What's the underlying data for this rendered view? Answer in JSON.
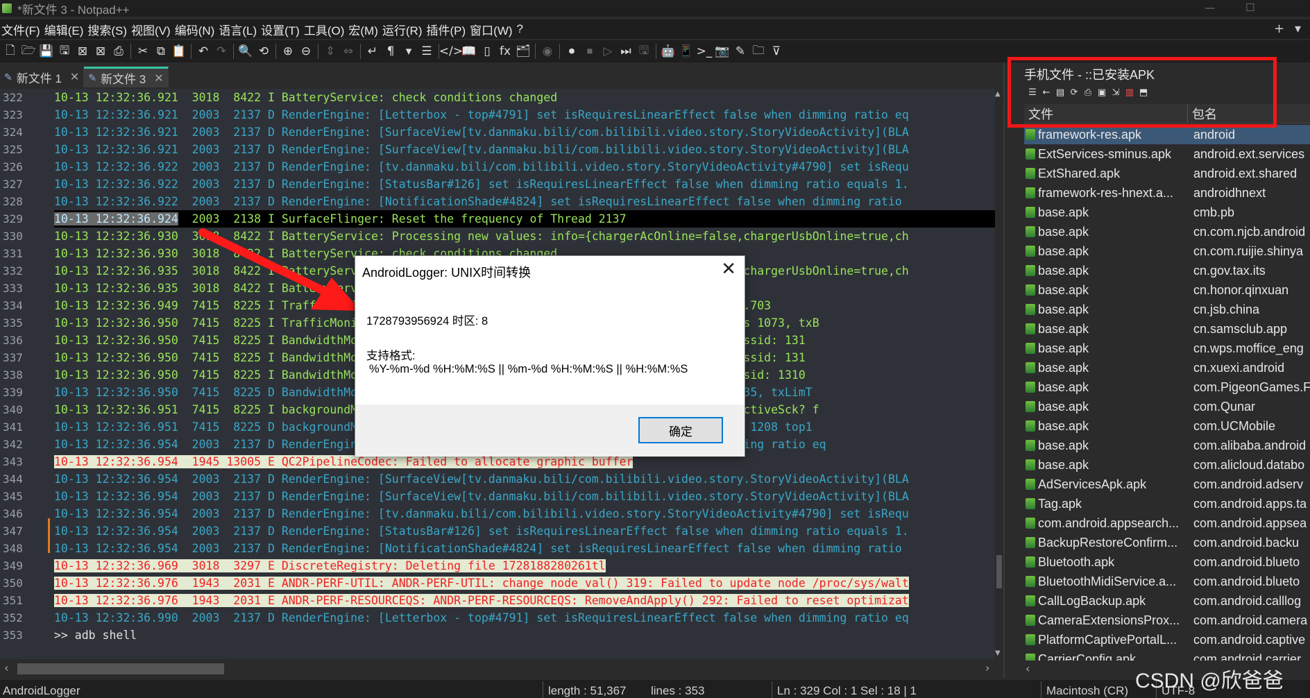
{
  "window": {
    "title": "*新文件 3 - Notpad++",
    "min": "—",
    "max": "☐"
  },
  "menu": [
    {
      "label": "文件(F)"
    },
    {
      "label": "编辑(E)"
    },
    {
      "label": "搜索(S)"
    },
    {
      "label": "视图(V)"
    },
    {
      "label": "编码(N)"
    },
    {
      "label": "语言(L)"
    },
    {
      "label": "设置(T)"
    },
    {
      "label": "工具(O)"
    },
    {
      "label": "宏(M)"
    },
    {
      "label": "运行(R)"
    },
    {
      "label": "插件(P)"
    },
    {
      "label": "窗口(W)"
    },
    {
      "label": "?"
    }
  ],
  "menu_right": {
    "plus": "+",
    "down": "▾"
  },
  "toolbar": [
    {
      "icon": "new-file-icon",
      "glyph": "🗋"
    },
    {
      "icon": "open-folder-icon",
      "glyph": "🗁"
    },
    {
      "icon": "save-icon",
      "glyph": "💾"
    },
    {
      "icon": "save-all-icon",
      "glyph": "🖫"
    },
    {
      "icon": "close-icon",
      "glyph": "⊠"
    },
    {
      "icon": "close-all-icon",
      "glyph": "⊠"
    },
    {
      "icon": "print-icon",
      "glyph": "⎙"
    },
    {
      "sep": true
    },
    {
      "icon": "cut-icon",
      "glyph": "✂"
    },
    {
      "icon": "copy-icon",
      "glyph": "⧉"
    },
    {
      "icon": "paste-icon",
      "glyph": "📋",
      "dis": true
    },
    {
      "sep": true
    },
    {
      "icon": "undo-icon",
      "glyph": "↶"
    },
    {
      "icon": "redo-icon",
      "glyph": "↷",
      "dis": true
    },
    {
      "sep": true
    },
    {
      "icon": "find-icon",
      "glyph": "🔍"
    },
    {
      "icon": "replace-icon",
      "glyph": "⟲"
    },
    {
      "sep": true
    },
    {
      "icon": "zoom-in-icon",
      "glyph": "⊕"
    },
    {
      "icon": "zoom-out-icon",
      "glyph": "⊖"
    },
    {
      "sep": true
    },
    {
      "icon": "sync-vertical-icon",
      "glyph": "⇕",
      "dis": true
    },
    {
      "icon": "sync-horizontal-icon",
      "glyph": "⇔",
      "dis": true
    },
    {
      "sep": true
    },
    {
      "icon": "word-wrap-icon",
      "glyph": "↵"
    },
    {
      "icon": "show-all-chars-icon",
      "glyph": "¶"
    },
    {
      "icon": "dropdown-icon",
      "glyph": "▾"
    },
    {
      "icon": "indent-guide-icon",
      "glyph": "☰"
    },
    {
      "sep": true
    },
    {
      "icon": "xml-tag-icon",
      "glyph": "</>"
    },
    {
      "icon": "book-icon",
      "glyph": "📖"
    },
    {
      "icon": "doc-map-icon",
      "glyph": "▯"
    },
    {
      "icon": "function-list-icon",
      "glyph": "fx"
    },
    {
      "icon": "folder-workspace-icon",
      "glyph": "🗂"
    },
    {
      "sep": true
    },
    {
      "icon": "monitor-icon",
      "glyph": "◉",
      "dis": true
    },
    {
      "sep": true
    },
    {
      "icon": "record-macro-icon",
      "glyph": "⏺"
    },
    {
      "icon": "stop-macro-icon",
      "glyph": "⏹",
      "dis": true
    },
    {
      "icon": "play-macro-icon",
      "glyph": "▷",
      "dis": true
    },
    {
      "icon": "run-macro-multiple-icon",
      "glyph": "⏭"
    },
    {
      "icon": "save-macro-icon",
      "glyph": "🖫",
      "dis": true
    },
    {
      "sep": true
    },
    {
      "icon": "android-icon",
      "glyph": "🤖"
    },
    {
      "icon": "phone-icon",
      "glyph": "📱"
    },
    {
      "icon": "terminal-icon",
      "glyph": ">_"
    },
    {
      "icon": "camera-icon",
      "glyph": "📷"
    },
    {
      "icon": "log-icon",
      "glyph": "✎"
    },
    {
      "icon": "folder-icon",
      "glyph": "🗀"
    },
    {
      "icon": "filter-icon",
      "glyph": "⊽"
    }
  ],
  "tabs": [
    {
      "label": "新文件 1",
      "close": "✕",
      "active": false
    },
    {
      "label": "新文件 3",
      "close": "✕",
      "active": true
    }
  ],
  "lines": [
    {
      "n": "322",
      "t": "I",
      "text": "10-13 12:32:36.921  3018  8422 I BatteryService: check conditions changed"
    },
    {
      "n": "323",
      "t": "D",
      "text": "10-13 12:32:36.921  2003  2137 D RenderEngine: [Letterbox - top#4791] set isRequiresLinearEffect false when dimming ratio eq"
    },
    {
      "n": "324",
      "t": "D",
      "text": "10-13 12:32:36.921  2003  2137 D RenderEngine: [SurfaceView[tv.danmaku.bili/com.bilibili.video.story.StoryVideoActivity](BLA"
    },
    {
      "n": "325",
      "t": "D",
      "text": "10-13 12:32:36.921  2003  2137 D RenderEngine: [SurfaceView[tv.danmaku.bili/com.bilibili.video.story.StoryVideoActivity](BLA"
    },
    {
      "n": "326",
      "t": "D",
      "text": "10-13 12:32:36.922  2003  2137 D RenderEngine: [tv.danmaku.bili/com.bilibili.video.story.StoryVideoActivity#4790] set isRequ"
    },
    {
      "n": "327",
      "t": "D",
      "text": "10-13 12:32:36.922  2003  2137 D RenderEngine: [StatusBar#126] set isRequiresLinearEffect false when dimming ratio equals 1."
    },
    {
      "n": "328",
      "t": "D",
      "text": "10-13 12:32:36.922  2003  2137 D RenderEngine: [NotificationShade#4824] set isRequiresLinearEffect false when dimming ratio"
    },
    {
      "n": "329",
      "t": "cur",
      "pre": "10-13 12:32:36.924",
      "text": "  2003  2138 I SurfaceFlinger: Reset the frequency of Thread 2137"
    },
    {
      "n": "330",
      "t": "I",
      "text": "10-13 12:32:36.930  3018  8422 I BatteryService: Processing new values: info={chargerAcOnline=false,chargerUsbOnline=true,ch"
    },
    {
      "n": "331",
      "t": "I",
      "text": "10-13 12:32:36.930  3018  8422 I BatteryService: check conditions changed"
    },
    {
      "n": "332",
      "t": "I",
      "text": "10-13 12:32:36.935  3018  8422 I BatteryService: Processing new values: info={chargerAcOnline=false,chargerUsbOnline=true,ch"
    },
    {
      "n": "333",
      "t": "I",
      "text": "10-13 12:32:36.935  3018  8422 I BatteryService: check conditions changed"
    },
    {
      "n": "334",
      "t": "I",
      "text": "10-13 12:32:36.949  7415  8225 I TrafficMonitor: ........................... 53.52, max rxhis: 47334.703"
    },
    {
      "n": "335",
      "t": "I",
      "text": "10-13 12:32:36.950  7415  8225 I TrafficMonitor: ........................... oid.networkstack, uid is 1073, txB"
    },
    {
      "n": "336",
      "t": "I",
      "text": "10-13 12:32:36.950  7415  8225 I BandwidthMonitor: ......................... 3416, Top 1 DownLinkClassid: 131"
    },
    {
      "n": "337",
      "t": "I",
      "text": "10-13 12:32:36.950  7415  8225 I BandwidthMonitor: ......................... 1708, Top 2 DownLinkClassid: 131"
    },
    {
      "n": "338",
      "t": "I",
      "text": "10-13 12:32:36.950  7415  8225 I BandwidthMonitor: ......................... 854, Top 3 DownLinkClassid: 1310"
    },
    {
      "n": "339",
      "t": "D",
      "text": "10-13 12:32:36.950  7415  8225 D BandwidthMonitor: ......................... Mbps, mEstLeftRatio: 0.35, txLimT"
    },
    {
      "n": "340",
      "t": "I",
      "text": "10-13 12:32:36.951  7415  8225 I backgroundMonitor: ........................ Update? false, mHasGetActiveSck? f"
    },
    {
      "n": "341",
      "t": "D",
      "text": "10-13 12:32:36.951  7415  8225 D backgroundMonitor: ........................ 22 top1UplinkTraffic is 1208 top1"
    },
    {
      "n": "342",
      "t": "D",
      "text": "10-13 12:32:36.954  2003  2137 D RenderEngine: .............................. effect false when dimming ratio eq"
    },
    {
      "n": "343",
      "t": "E",
      "text": "10-13 12:32:36.954  1945 13005 E QC2PipelineCodec: Failed to allocate graphic buffer"
    },
    {
      "n": "344",
      "t": "D",
      "text": "10-13 12:32:36.954  2003  2137 D RenderEngine: [SurfaceView[tv.danmaku.bili/com.bilibili.video.story.StoryVideoActivity](BLA"
    },
    {
      "n": "345",
      "t": "D",
      "text": "10-13 12:32:36.954  2003  2137 D RenderEngine: [SurfaceView[tv.danmaku.bili/com.bilibili.video.story.StoryVideoActivity](BLA"
    },
    {
      "n": "346",
      "t": "D",
      "text": "10-13 12:32:36.954  2003  2137 D RenderEngine: [tv.danmaku.bili/com.bilibili.video.story.StoryVideoActivity#4790] set isRequ"
    },
    {
      "n": "347",
      "t": "D",
      "text": "10-13 12:32:36.954  2003  2137 D RenderEngine: [StatusBar#126] set isRequiresLinearEffect false when dimming ratio equals 1."
    },
    {
      "n": "348",
      "t": "D",
      "text": "10-13 12:32:36.954  2003  2137 D RenderEngine: [NotificationShade#4824] set isRequiresLinearEffect false when dimming ratio"
    },
    {
      "n": "349",
      "t": "E",
      "text": "10-13 12:32:36.969  3018  3297 E DiscreteRegistry: Deleting file 1728188280261tl"
    },
    {
      "n": "350",
      "t": "E",
      "text": "10-13 12:32:36.976  1943  2031 E ANDR-PERF-UTIL: ANDR-PERF-UTIL: change_node_val() 319: Failed to update node /proc/sys/walt"
    },
    {
      "n": "351",
      "t": "E",
      "text": "10-13 12:32:36.976  1943  2031 E ANDR-PERF-RESOURCEQS: ANDR-PERF-RESOURCEQS: RemoveAndApply() 292: Failed to reset optimizat"
    },
    {
      "n": "352",
      "t": "D",
      "text": "10-13 12:32:36.990  2003  2137 D RenderEngine: [Letterbox - top#4791] set isRequiresLinearEffect false when dimming ratio eq"
    },
    {
      "n": "353",
      "t": "cmd",
      "text": ">> adb shell"
    }
  ],
  "panel": {
    "title": "手机文件 - ::已安装APK",
    "col_file": "文件",
    "col_pkg": "包名",
    "tool_icons": [
      {
        "name": "list-icon",
        "g": "☰",
        "red": false
      },
      {
        "name": "back-icon",
        "g": "←",
        "red": false
      },
      {
        "name": "doc-icon",
        "g": "▤",
        "red": false
      },
      {
        "name": "refresh-icon",
        "g": "⟳",
        "red": false
      },
      {
        "name": "print-icon",
        "g": "⎙",
        "red": false
      },
      {
        "name": "save-icon",
        "g": "▣",
        "red": false
      },
      {
        "name": "export-icon",
        "g": "⇲",
        "red": false
      },
      {
        "name": "delete-icon",
        "g": "▥",
        "red": true
      },
      {
        "name": "install-icon",
        "g": "⬒",
        "red": false
      }
    ],
    "rows": [
      {
        "file": "framework-res.apk",
        "pkg": "android",
        "sel": true
      },
      {
        "file": "ExtServices-sminus.apk",
        "pkg": "android.ext.services"
      },
      {
        "file": "ExtShared.apk",
        "pkg": "android.ext.shared"
      },
      {
        "file": "framework-res-hnext.a...",
        "pkg": "androidhnext"
      },
      {
        "file": "base.apk",
        "pkg": "cmb.pb"
      },
      {
        "file": "base.apk",
        "pkg": "cn.com.njcb.android"
      },
      {
        "file": "base.apk",
        "pkg": "cn.com.ruijie.shinya"
      },
      {
        "file": "base.apk",
        "pkg": "cn.gov.tax.its"
      },
      {
        "file": "base.apk",
        "pkg": "cn.honor.qinxuan"
      },
      {
        "file": "base.apk",
        "pkg": "cn.jsb.china"
      },
      {
        "file": "base.apk",
        "pkg": "cn.samsclub.app"
      },
      {
        "file": "base.apk",
        "pkg": "cn.wps.moffice_eng"
      },
      {
        "file": "base.apk",
        "pkg": "cn.xuexi.android"
      },
      {
        "file": "base.apk",
        "pkg": "com.PigeonGames.F"
      },
      {
        "file": "base.apk",
        "pkg": "com.Qunar"
      },
      {
        "file": "base.apk",
        "pkg": "com.UCMobile"
      },
      {
        "file": "base.apk",
        "pkg": "com.alibaba.android"
      },
      {
        "file": "base.apk",
        "pkg": "com.alicloud.databo"
      },
      {
        "file": "AdServicesApk.apk",
        "pkg": "com.android.adserv"
      },
      {
        "file": "Tag.apk",
        "pkg": "com.android.apps.ta"
      },
      {
        "file": "com.android.appsearch...",
        "pkg": "com.android.appsea"
      },
      {
        "file": "BackupRestoreConfirm...",
        "pkg": "com.android.backu"
      },
      {
        "file": "Bluetooth.apk",
        "pkg": "com.android.blueto"
      },
      {
        "file": "BluetoothMidiService.a...",
        "pkg": "com.android.blueto"
      },
      {
        "file": "CallLogBackup.apk",
        "pkg": "com.android.calllog"
      },
      {
        "file": "CameraExtensionsProx...",
        "pkg": "com.android.camera"
      },
      {
        "file": "PlatformCaptivePortalL...",
        "pkg": "com.android.captive"
      },
      {
        "file": "CarrierConfig.apk",
        "pkg": "com.android.carrier"
      }
    ]
  },
  "dialog": {
    "title": "AndroidLogger: UNIX时间转换",
    "close": "✕",
    "line1": "1728793956924 时区: 8",
    "line2": "支持格式:",
    "line3": "%Y-%m-%d %H:%M:%S || %m-%d %H:%M:%S || %H:%M:%S",
    "ok": "确定"
  },
  "status": {
    "left": "AndroidLogger",
    "length": "length : 51,367",
    "lines": "lines : 353",
    "pos": "Ln : 329    Col : 1    Sel : 18 | 1",
    "eol": "Macintosh (CR)",
    "enc": "UTF-8"
  },
  "watermark": "CSDN @欣爸爸",
  "colors": {
    "accent": "#37c7a5",
    "annotation": "#f01818",
    "error_text": "#ee2222",
    "info_text": "#9be35a",
    "debug_text": "#3aa6c8"
  }
}
